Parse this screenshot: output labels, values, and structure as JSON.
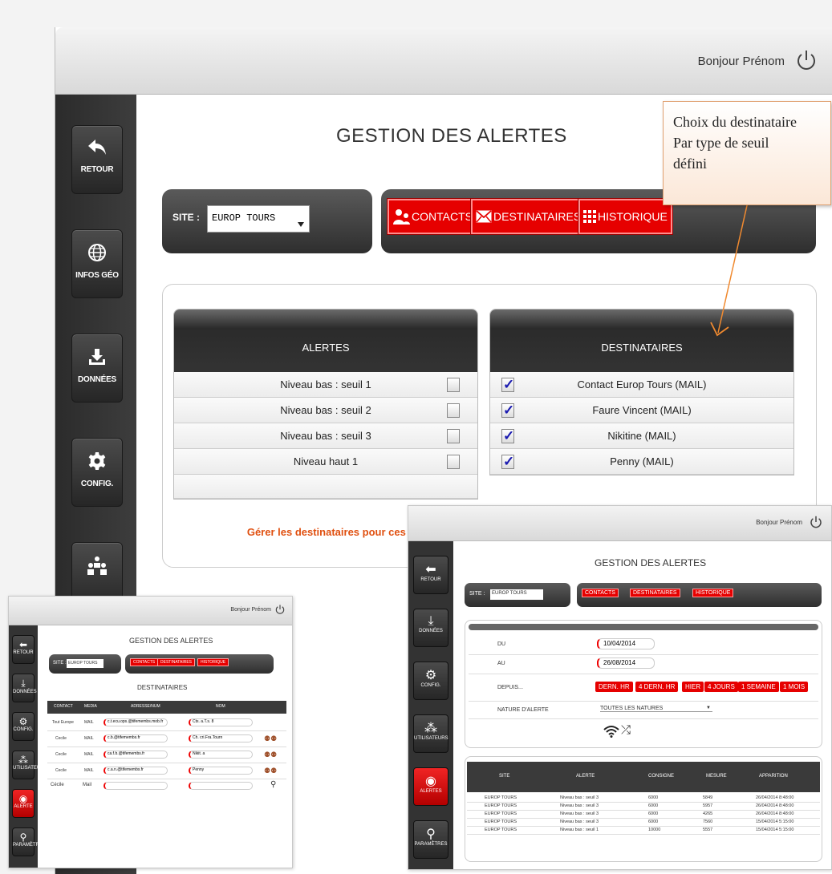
{
  "main": {
    "greeting": "Bonjour Prénom",
    "title": "GESTION DES ALERTES",
    "nav": [
      {
        "label": "RETOUR"
      },
      {
        "label": "INFOS GÉO"
      },
      {
        "label": "DONNÉES"
      },
      {
        "label": "CONFIG."
      }
    ],
    "site_label": "SITE :",
    "site_value": "EUROP TOURS",
    "tabs": {
      "contacts": "CONTACTS",
      "destinataires": "DESTINATAIRES",
      "historique": "HISTORIQUE"
    },
    "alerts_header": "ALERTES",
    "recipients_header": "DESTINATAIRES",
    "alerts": [
      "Niveau bas : seuil 1",
      "Niveau bas : seuil 2",
      "Niveau bas : seuil 3",
      "Niveau haut 1"
    ],
    "recipients": [
      "Contact Europ Tours (MAIL)",
      "Faure Vincent (MAIL)",
      "Nikitine (MAIL)",
      "Penny (MAIL)"
    ],
    "manage_link": "Gérer les destinataires pour ces alertes >>"
  },
  "callout": {
    "lines": [
      "Choix du destinataire",
      "Par type de seuil",
      "défini"
    ]
  },
  "history_screen": {
    "greeting": "Bonjour Prénom",
    "title": "GESTION DES ALERTES",
    "site_label": "SITE :",
    "site_value": "EUROP TOURS",
    "tabs": {
      "contacts": "CONTACTS",
      "destinataires": "DESTINATAIRES",
      "historique": "HISTORIQUE"
    },
    "nav": [
      "RETOUR",
      "DONNÉES",
      "CONFIG.",
      "UTILISATEURS",
      "ALERTES",
      "PARAMÈTRES"
    ],
    "du_label": "DU",
    "du_value": "10/04/2014",
    "au_label": "AU",
    "au_value": "26/08/2014",
    "depuis_label": "DEPUIS...",
    "depuis_buttons": [
      "DERN. HR",
      "4 DERN. HR",
      "HIER",
      "4 JOURS",
      "1 SEMAINE",
      "1 MOIS"
    ],
    "nature_label": "NATURE D'ALERTE",
    "nature_value": "TOUTES LES NATURES",
    "columns": [
      "SITE",
      "ALERTE",
      "CONSIGNE",
      "MESURE",
      "APPARITION"
    ],
    "rows": [
      [
        "EUROP TOURS",
        "Niveau bas : seuil 3",
        "6000",
        "5849",
        "26/04/2014 8:48:00"
      ],
      [
        "EUROP TOURS",
        "Niveau bas : seuil 3",
        "6000",
        "5957",
        "26/04/2014 8:48:00"
      ],
      [
        "EUROP TOURS",
        "Niveau bas : seuil 3",
        "6000",
        "4265",
        "26/04/2014 8:48:00"
      ],
      [
        "EUROP TOURS",
        "Niveau bas : seuil 3",
        "6000",
        "7560",
        "15/04/2014 5:15:00"
      ],
      [
        "EUROP TOURS",
        "Niveau bas : seuil 1",
        "10000",
        "5557",
        "15/04/2014 5:15:00"
      ]
    ]
  },
  "recipients_screen": {
    "greeting": "Bonjour Prénom",
    "title": "GESTION DES ALERTES",
    "subtitle": "DESTINATAIRES",
    "site_label": "SITE :",
    "site_value": "EUROP TOURS",
    "tabs": {
      "contacts": "CONTACTS",
      "destinataires": "DESTINATAIRES",
      "historique": "HISTORIQUE"
    },
    "nav": [
      "RETOUR",
      "DONNÉES",
      "CONFIG.",
      "UTILISATEURS",
      "ALERTE",
      "PARAMÈTRES"
    ],
    "columns": [
      "CONTACT",
      "MEDIA",
      "ADRESSE/NUM",
      "NOM"
    ],
    "rows": [
      [
        "Tout Europe",
        "MAIL",
        "c.t.ecu.ops.@tifemembs.mob.fr",
        "Cts. a.T.s. 8"
      ],
      [
        "Cecile",
        "MAIL",
        "c.b.@tifemembs.fr",
        "Ch. cri.Fra.Tourn"
      ],
      [
        "Cecile",
        "MAIL",
        "ca.f.b.@tifemembs.fr",
        "Nikit. a"
      ],
      [
        "Cecile",
        "MAIL",
        "c.a.n.@tifemembs.fr",
        "Penny"
      ]
    ],
    "new_contact": "Cécile",
    "new_media": "Mail"
  },
  "colors": {
    "accent_red": "#e60000",
    "sidebar": "#333333",
    "callout_border": "#e0a070",
    "link_orange": "#e05010"
  }
}
